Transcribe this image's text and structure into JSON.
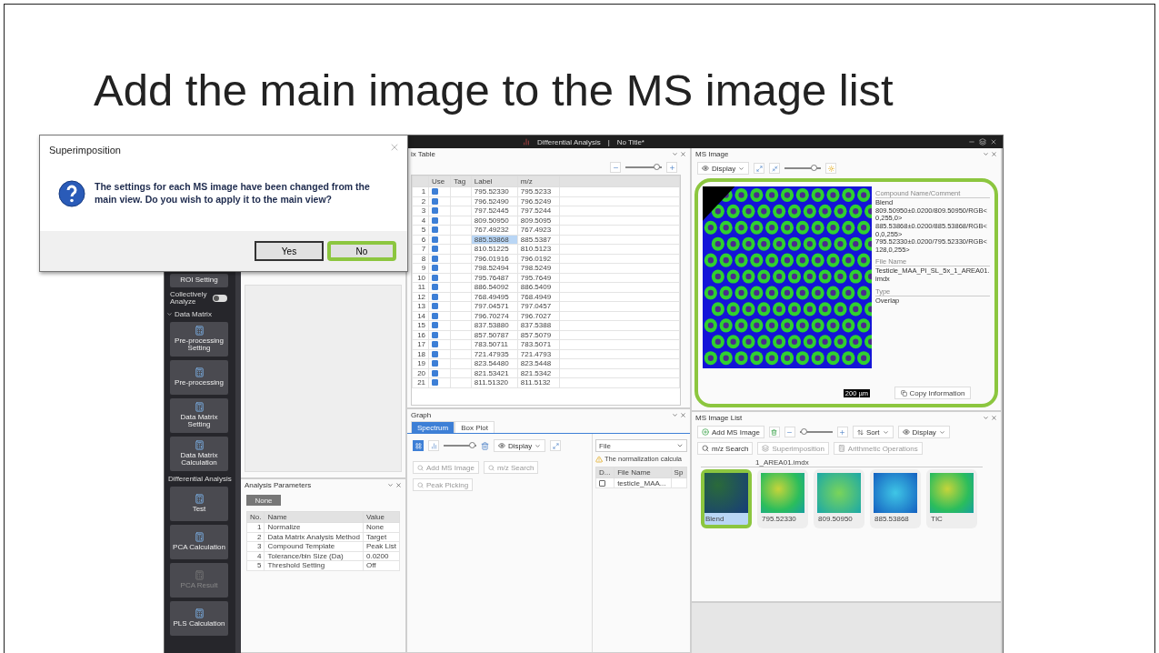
{
  "slide": {
    "title": "Add the main image to the MS image list"
  },
  "app": {
    "title": "Differential Analysis",
    "separator": "|",
    "document": "No Title*"
  },
  "dialog": {
    "title": "Superimposition",
    "message": "The settings for each MS image have been changed from the main view. Do you wish to apply it to the main view?",
    "buttons": [
      {
        "label": "Yes",
        "highlighted": false
      },
      {
        "label": "No",
        "highlighted": true
      }
    ]
  },
  "sidebar": {
    "top_button": "ROI Setting",
    "toggle": {
      "label": "Collectively Analyze",
      "on": false
    },
    "sections": [
      {
        "label": "Data Matrix",
        "expanded": true,
        "items": [
          {
            "label": "Pre-processing Setting",
            "disabled": false
          },
          {
            "label": "Pre-processing",
            "disabled": false
          },
          {
            "label": "Data Matrix Setting",
            "disabled": false
          },
          {
            "label": "Data Matrix Calculation",
            "disabled": false
          }
        ]
      },
      {
        "label": "Differential Analysis",
        "expanded": true,
        "items": [
          {
            "label": "Test",
            "disabled": false
          },
          {
            "label": "PCA Calculation",
            "disabled": false
          },
          {
            "label": "PCA Result",
            "disabled": true
          },
          {
            "label": "PLS Calculation",
            "disabled": false
          }
        ]
      }
    ]
  },
  "analysis_parameters": {
    "title": "Analysis Parameters",
    "button": "None",
    "columns": [
      "No.",
      "Name",
      "Value"
    ],
    "rows": [
      [
        "1",
        "Normalize",
        "None"
      ],
      [
        "2",
        "Data Matrix Analysis Method",
        "Target"
      ],
      [
        "3",
        "Compound Template",
        "Peak List"
      ],
      [
        "4",
        "Tolerance/bin Size (Da)",
        "0.0200"
      ],
      [
        "5",
        "Threshold Setting",
        "Off"
      ]
    ]
  },
  "matrix_table": {
    "title": "ix Table",
    "zoom": {
      "level": 0.85
    },
    "columns": [
      "Use",
      "Tag",
      "Label",
      "m/z"
    ],
    "rows": [
      {
        "no": "1",
        "use": true,
        "label": "795.52330",
        "mz": "795.5233",
        "selected": false
      },
      {
        "no": "2",
        "use": true,
        "label": "796.52490",
        "mz": "796.5249",
        "selected": false
      },
      {
        "no": "3",
        "use": true,
        "label": "797.52445",
        "mz": "797.5244",
        "selected": false
      },
      {
        "no": "4",
        "use": true,
        "label": "809.50950",
        "mz": "809.5095",
        "selected": false
      },
      {
        "no": "5",
        "use": true,
        "label": "767.49232",
        "mz": "767.4923",
        "selected": false
      },
      {
        "no": "6",
        "use": true,
        "label": "885.53868",
        "mz": "885.5387",
        "selected": true
      },
      {
        "no": "7",
        "use": true,
        "label": "810.51225",
        "mz": "810.5123",
        "selected": false
      },
      {
        "no": "8",
        "use": true,
        "label": "796.01916",
        "mz": "796.0192",
        "selected": false
      },
      {
        "no": "9",
        "use": true,
        "label": "798.52494",
        "mz": "798.5249",
        "selected": false
      },
      {
        "no": "10",
        "use": true,
        "label": "795.76487",
        "mz": "795.7649",
        "selected": false
      },
      {
        "no": "11",
        "use": true,
        "label": "886.54092",
        "mz": "886.5409",
        "selected": false
      },
      {
        "no": "12",
        "use": true,
        "label": "768.49495",
        "mz": "768.4949",
        "selected": false
      },
      {
        "no": "13",
        "use": true,
        "label": "797.04571",
        "mz": "797.0457",
        "selected": false
      },
      {
        "no": "14",
        "use": true,
        "label": "796.70274",
        "mz": "796.7027",
        "selected": false
      },
      {
        "no": "15",
        "use": true,
        "label": "837.53880",
        "mz": "837.5388",
        "selected": false
      },
      {
        "no": "16",
        "use": true,
        "label": "857.50787",
        "mz": "857.5079",
        "selected": false
      },
      {
        "no": "17",
        "use": true,
        "label": "783.50711",
        "mz": "783.5071",
        "selected": false
      },
      {
        "no": "18",
        "use": true,
        "label": "721.47935",
        "mz": "721.4793",
        "selected": false
      },
      {
        "no": "19",
        "use": true,
        "label": "823.54480",
        "mz": "823.5448",
        "selected": false
      },
      {
        "no": "20",
        "use": true,
        "label": "821.53421",
        "mz": "821.5342",
        "selected": false
      },
      {
        "no": "21",
        "use": true,
        "label": "811.51320",
        "mz": "811.5132",
        "selected": false
      }
    ]
  },
  "ms_image": {
    "title": "MS Image",
    "display": "Display",
    "zoom": {
      "level": 0.8
    },
    "highlighted": true,
    "scale": "200 µm",
    "info": [
      {
        "label": "Compound Name/Comment",
        "value": "Blend\n809.50950±0.0200/809.50950/RGB<0,255,0>\n885.53868±0.0200/885.53868/RGB<0,0,255>\n795.52330±0.0200/795.52330/RGB<128,0,255>"
      },
      {
        "label": "File Name",
        "value": "Testicle_MAA_PI_SL_5x_1_AREA01.imdx"
      },
      {
        "label": "Type",
        "value": "Overlap"
      }
    ],
    "copy_button": "Copy Information"
  },
  "graph": {
    "title": "Graph",
    "tabs": [
      {
        "label": "Spectrum",
        "selected": true
      },
      {
        "label": "Box Plot",
        "selected": false
      }
    ],
    "zoom": {
      "level": 0.85
    },
    "display": "Display",
    "buttons": [
      {
        "label": "Add MS Image",
        "disabled": true
      },
      {
        "label": "m/z Search",
        "disabled": true
      },
      {
        "label": "Peak Picking",
        "disabled": true
      }
    ],
    "file_select": "File",
    "warning": "The normalization calcula",
    "files": {
      "columns": [
        "D...",
        "File Name",
        "Sp"
      ],
      "rows": [
        {
          "checked": false,
          "name": "testicle_MAA..."
        }
      ]
    }
  },
  "ms_image_list": {
    "title": "MS Image List",
    "add_button": "Add MS Image",
    "zoom": {
      "level": 0.1
    },
    "sort": "Sort",
    "display": "Display",
    "search_button": "m/z Search",
    "superimposition": "Superimposition",
    "arithmetic": "Arithmetic Operations",
    "group": "1_AREA01.imdx",
    "thumbnails": [
      {
        "label": "Blend",
        "kind": "blend",
        "selected": true,
        "highlighted": true
      },
      {
        "label": "795.52330",
        "kind": "heatmap",
        "selected": false,
        "highlighted": false
      },
      {
        "label": "809.50950",
        "kind": "teal",
        "selected": false,
        "highlighted": false
      },
      {
        "label": "885.53868",
        "kind": "cells",
        "selected": false,
        "highlighted": false
      },
      {
        "label": "TIC",
        "kind": "heatmap",
        "selected": false,
        "highlighted": false
      }
    ]
  }
}
